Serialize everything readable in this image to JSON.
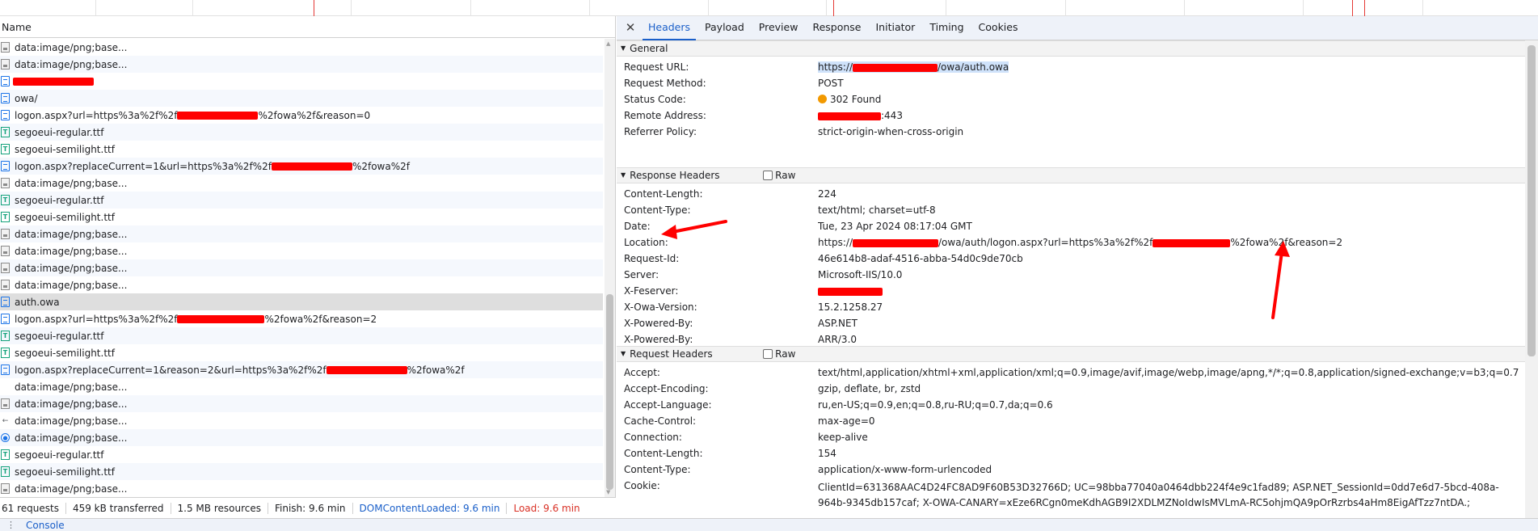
{
  "requests": {
    "header": "Name",
    "items": [
      {
        "icon": "image",
        "label": "data:image/png;base..."
      },
      {
        "icon": "image",
        "label": "data:image/png;base..."
      },
      {
        "icon": "document",
        "label": ""
      },
      {
        "icon": "document",
        "label": "owa/"
      },
      {
        "icon": "document",
        "label": "logon.aspx?url=https%3a%2f%2f",
        "suffix": "%2fowa%2f&reason=0"
      },
      {
        "icon": "font",
        "label": "segoeui-regular.ttf"
      },
      {
        "icon": "font",
        "label": "segoeui-semilight.ttf"
      },
      {
        "icon": "document",
        "label": "logon.aspx?replaceCurrent=1&url=https%3a%2f%2f",
        "suffix": "%2fowa%2f"
      },
      {
        "icon": "image",
        "label": "data:image/png;base..."
      },
      {
        "icon": "font",
        "label": "segoeui-regular.ttf"
      },
      {
        "icon": "font",
        "label": "segoeui-semilight.ttf"
      },
      {
        "icon": "image",
        "label": "data:image/png;base..."
      },
      {
        "icon": "image",
        "label": "data:image/png;base..."
      },
      {
        "icon": "image",
        "label": "data:image/png;base..."
      },
      {
        "icon": "image",
        "label": "data:image/png;base..."
      },
      {
        "icon": "document",
        "label": "auth.owa",
        "selected": true
      },
      {
        "icon": "document",
        "label": "logon.aspx?url=https%3a%2f%2f",
        "suffix": "%2fowa%2f&reason=2"
      },
      {
        "icon": "font",
        "label": "segoeui-regular.ttf"
      },
      {
        "icon": "font",
        "label": "segoeui-semilight.ttf"
      },
      {
        "icon": "document",
        "label": "logon.aspx?replaceCurrent=1&reason=2&url=https%3a%2f%2f",
        "suffix": "%2fowa%2f"
      },
      {
        "icon": "none",
        "label": "data:image/png;base..."
      },
      {
        "icon": "image",
        "label": "data:image/png;base..."
      },
      {
        "icon": "dash",
        "label": "data:image/png;base..."
      },
      {
        "icon": "circle",
        "label": "data:image/png;base..."
      },
      {
        "icon": "font",
        "label": "segoeui-regular.ttf"
      },
      {
        "icon": "font",
        "label": "segoeui-semilight.ttf"
      },
      {
        "icon": "image",
        "label": "data:image/png;base..."
      }
    ]
  },
  "status": {
    "requests": "61 requests",
    "transferred": "459 kB transferred",
    "resources": "1.5 MB resources",
    "finish": "Finish: 9.6 min",
    "dcl": "DOMContentLoaded: 9.6 min",
    "load": "Load: 9.6 min"
  },
  "drawer": {
    "dots": "⋮",
    "tab": "Console"
  },
  "tabs": [
    "Headers",
    "Payload",
    "Preview",
    "Response",
    "Initiator",
    "Timing",
    "Cookies"
  ],
  "close_glyph": "✕",
  "general": {
    "title": "General",
    "rows": [
      {
        "key": "Request URL:",
        "pre": "https://",
        "post": "/owa/auth.owa"
      },
      {
        "key": "Request Method:",
        "value": "POST"
      },
      {
        "key": "Status Code:",
        "value": "302 Found"
      },
      {
        "key": "Remote Address:",
        "post": ":443"
      },
      {
        "key": "Referrer Policy:",
        "value": "strict-origin-when-cross-origin"
      }
    ]
  },
  "response_headers": {
    "title": "Response Headers",
    "raw": "Raw",
    "rows": [
      {
        "key": "Content-Length:",
        "value": "224"
      },
      {
        "key": "Content-Type:",
        "value": "text/html; charset=utf-8"
      },
      {
        "key": "Date:",
        "value": "Tue, 23 Apr 2024 08:17:04 GMT"
      },
      {
        "key": "Location:",
        "pre": "https://",
        "mid": "/owa/auth/logon.aspx?url=https%3a%2f%2f",
        "post": "%2fowa%2f&reason=2"
      },
      {
        "key": "Request-Id:",
        "value": "46e614b8-adaf-4516-abba-54d0c9de70cb"
      },
      {
        "key": "Server:",
        "value": "Microsoft-IIS/10.0"
      },
      {
        "key": "X-Feserver:",
        "value": ""
      },
      {
        "key": "X-Owa-Version:",
        "value": "15.2.1258.27"
      },
      {
        "key": "X-Powered-By:",
        "value": "ASP.NET"
      },
      {
        "key": "X-Powered-By:",
        "value": "ARR/3.0"
      }
    ]
  },
  "request_headers": {
    "title": "Request Headers",
    "raw": "Raw",
    "rows": [
      {
        "key": "Accept:",
        "value": "text/html,application/xhtml+xml,application/xml;q=0.9,image/avif,image/webp,image/apng,*/*;q=0.8,application/signed-exchange;v=b3;q=0.7"
      },
      {
        "key": "Accept-Encoding:",
        "value": "gzip, deflate, br, zstd"
      },
      {
        "key": "Accept-Language:",
        "value": "ru,en-US;q=0.9,en;q=0.8,ru-RU;q=0.7,da;q=0.6"
      },
      {
        "key": "Cache-Control:",
        "value": "max-age=0"
      },
      {
        "key": "Connection:",
        "value": "keep-alive"
      },
      {
        "key": "Content-Length:",
        "value": "154"
      },
      {
        "key": "Content-Type:",
        "value": "application/x-www-form-urlencoded"
      },
      {
        "key": "Cookie:",
        "value": "ClientId=631368AAC4D24FC8AD9F60B53D32766D; UC=98bba77040a0464dbb224f4e9c1fad89; ASP.NET_SessionId=0dd7e6d7-5bcd-408a-964b-9345db157caf; X-OWA-CANARY=xEze6RCgn0meKdhAGB9I2XDLMZNoIdwIsMVLmA-RC5ohjmQA9pOrRzrbs4aHm8EigAfTzz7ntDA.;"
      }
    ]
  },
  "colors": {
    "accent": "#1a5fc9",
    "redaction": "#ff0000",
    "status_warning": "#f29900",
    "load_red": "#d93025"
  }
}
